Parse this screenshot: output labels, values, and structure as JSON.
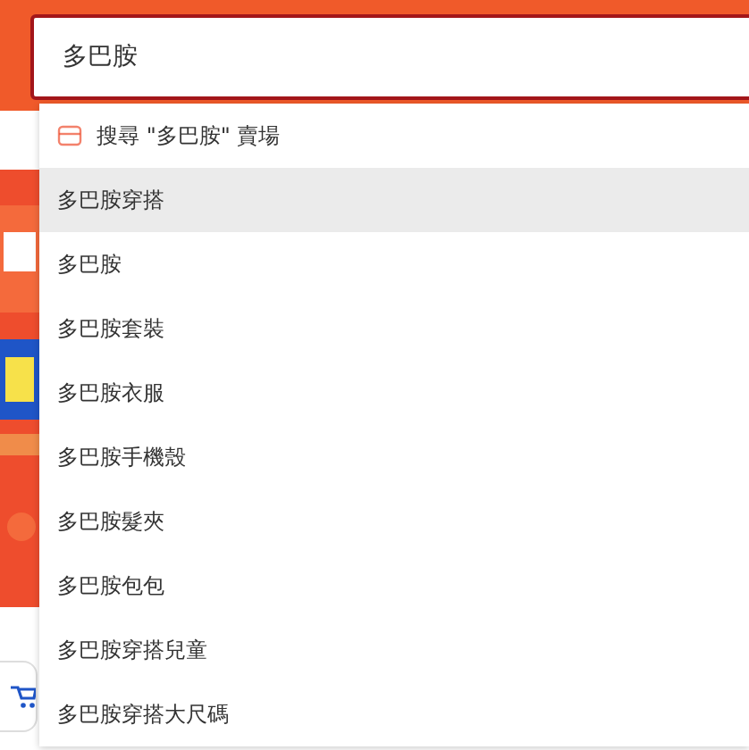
{
  "search": {
    "value": "多巴胺"
  },
  "suggestions": [
    {
      "kind": "store",
      "label": "搜尋 \"多巴胺\" 賣場",
      "selected": false
    },
    {
      "kind": "term",
      "label": "多巴胺穿搭",
      "selected": true
    },
    {
      "kind": "term",
      "label": "多巴胺",
      "selected": false
    },
    {
      "kind": "term",
      "label": "多巴胺套裝",
      "selected": false
    },
    {
      "kind": "term",
      "label": "多巴胺衣服",
      "selected": false
    },
    {
      "kind": "term",
      "label": "多巴胺手機殼",
      "selected": false
    },
    {
      "kind": "term",
      "label": "多巴胺髮夾",
      "selected": false
    },
    {
      "kind": "term",
      "label": "多巴胺包包",
      "selected": false
    },
    {
      "kind": "term",
      "label": "多巴胺穿搭兒童",
      "selected": false
    },
    {
      "kind": "term",
      "label": "多巴胺穿搭大尺碼",
      "selected": false
    }
  ]
}
